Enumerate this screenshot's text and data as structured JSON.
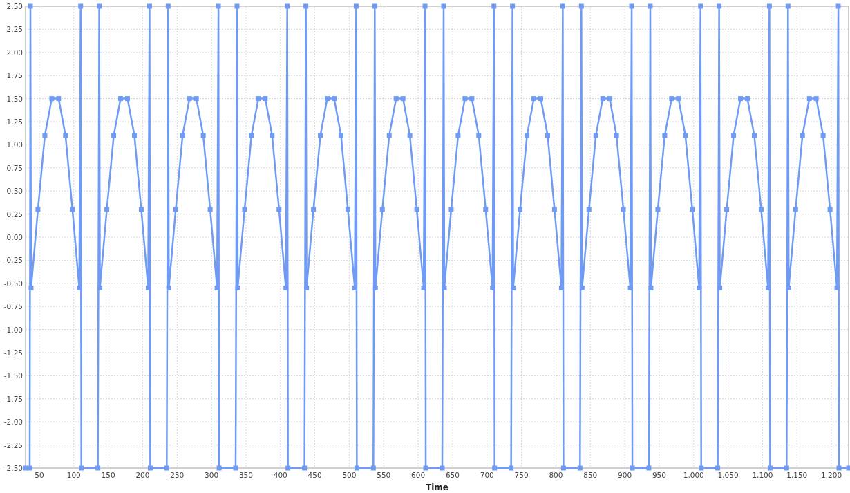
{
  "chart": {
    "chart_data": {
      "type": "line",
      "xlabel": "Time",
      "grid": true,
      "xlim": [
        30,
        1225
      ],
      "ylim": [
        -2.5,
        2.5
      ],
      "x": [
        30,
        36,
        37,
        38,
        48,
        58,
        68,
        78,
        88,
        98,
        108,
        110,
        111,
        135,
        137,
        138,
        148,
        158,
        168,
        178,
        188,
        198,
        208,
        210,
        211,
        235,
        237,
        238,
        248,
        258,
        268,
        278,
        288,
        298,
        308,
        310,
        311,
        335,
        337,
        338,
        348,
        358,
        368,
        378,
        388,
        398,
        408,
        410,
        411,
        435,
        437,
        438,
        448,
        458,
        468,
        478,
        488,
        498,
        508,
        510,
        511,
        535,
        537,
        538,
        548,
        558,
        568,
        578,
        588,
        598,
        608,
        610,
        611,
        635,
        637,
        638,
        648,
        658,
        668,
        678,
        688,
        698,
        708,
        710,
        711,
        735,
        737,
        738,
        748,
        758,
        768,
        778,
        788,
        798,
        808,
        810,
        811,
        835,
        837,
        838,
        848,
        858,
        868,
        878,
        888,
        898,
        908,
        910,
        911,
        935,
        937,
        938,
        948,
        958,
        968,
        978,
        988,
        998,
        1008,
        1010,
        1011,
        1035,
        1037,
        1038,
        1048,
        1058,
        1068,
        1078,
        1088,
        1098,
        1108,
        1110,
        1111,
        1135,
        1137,
        1138,
        1148,
        1158,
        1168,
        1178,
        1188,
        1198,
        1208,
        1210,
        1211,
        1225
      ],
      "series": [
        {
          "color": "#6f9bf4",
          "marker": "square",
          "values": [
            -2.5,
            -2.5,
            2.5,
            -0.55,
            0.3,
            1.1,
            1.5,
            1.5,
            1.1,
            0.3,
            -0.55,
            2.5,
            -2.5,
            -2.5,
            2.5,
            -0.55,
            0.3,
            1.1,
            1.5,
            1.5,
            1.1,
            0.3,
            -0.55,
            2.5,
            -2.5,
            -2.5,
            2.5,
            -0.55,
            0.3,
            1.1,
            1.5,
            1.5,
            1.1,
            0.3,
            -0.55,
            2.5,
            -2.5,
            -2.5,
            2.5,
            -0.55,
            0.3,
            1.1,
            1.5,
            1.5,
            1.1,
            0.3,
            -0.55,
            2.5,
            -2.5,
            -2.5,
            2.5,
            -0.55,
            0.3,
            1.1,
            1.5,
            1.5,
            1.1,
            0.3,
            -0.55,
            2.5,
            -2.5,
            -2.5,
            2.5,
            -0.55,
            0.3,
            1.1,
            1.5,
            1.5,
            1.1,
            0.3,
            -0.55,
            2.5,
            -2.5,
            -2.5,
            2.5,
            -0.55,
            0.3,
            1.1,
            1.5,
            1.5,
            1.1,
            0.3,
            -0.55,
            2.5,
            -2.5,
            -2.5,
            2.5,
            -0.55,
            0.3,
            1.1,
            1.5,
            1.5,
            1.1,
            0.3,
            -0.55,
            2.5,
            -2.5,
            -2.5,
            2.5,
            -0.55,
            0.3,
            1.1,
            1.5,
            1.5,
            1.1,
            0.3,
            -0.55,
            2.5,
            -2.5,
            -2.5,
            2.5,
            -0.55,
            0.3,
            1.1,
            1.5,
            1.5,
            1.1,
            0.3,
            -0.55,
            2.5,
            -2.5,
            -2.5,
            2.5,
            -0.55,
            0.3,
            1.1,
            1.5,
            1.5,
            1.1,
            0.3,
            -0.55,
            2.5,
            -2.5,
            -2.5,
            2.5,
            -0.55,
            0.3,
            1.1,
            1.5,
            1.5,
            1.1,
            0.3,
            -0.55,
            2.5,
            -2.5,
            -2.5
          ]
        }
      ],
      "xticks": [
        {
          "value": 50,
          "label": "50"
        },
        {
          "value": 100,
          "label": "100"
        },
        {
          "value": 150,
          "label": "150"
        },
        {
          "value": 200,
          "label": "200"
        },
        {
          "value": 250,
          "label": "250"
        },
        {
          "value": 300,
          "label": "300"
        },
        {
          "value": 350,
          "label": "350"
        },
        {
          "value": 400,
          "label": "400"
        },
        {
          "value": 450,
          "label": "450"
        },
        {
          "value": 500,
          "label": "500"
        },
        {
          "value": 550,
          "label": "550"
        },
        {
          "value": 600,
          "label": "600"
        },
        {
          "value": 650,
          "label": "650"
        },
        {
          "value": 700,
          "label": "700"
        },
        {
          "value": 750,
          "label": "750"
        },
        {
          "value": 800,
          "label": "800"
        },
        {
          "value": 850,
          "label": "850"
        },
        {
          "value": 900,
          "label": "900"
        },
        {
          "value": 950,
          "label": "950"
        },
        {
          "value": 1000,
          "label": "1,000"
        },
        {
          "value": 1050,
          "label": "1,050"
        },
        {
          "value": 1100,
          "label": "1,100"
        },
        {
          "value": 1150,
          "label": "1,150"
        },
        {
          "value": 1200,
          "label": "1,200"
        }
      ],
      "yticks": [
        {
          "value": 2.5,
          "label": "2.50"
        },
        {
          "value": 2.25,
          "label": "2.25"
        },
        {
          "value": 2,
          "label": "2.00"
        },
        {
          "value": 1.75,
          "label": "1.75"
        },
        {
          "value": 1.5,
          "label": "1.50"
        },
        {
          "value": 1.25,
          "label": "1.25"
        },
        {
          "value": 1,
          "label": "1.00"
        },
        {
          "value": 0.75,
          "label": "0.75"
        },
        {
          "value": 0.5,
          "label": "0.50"
        },
        {
          "value": 0.25,
          "label": "0.25"
        },
        {
          "value": 0,
          "label": "0.00"
        },
        {
          "value": -0.25,
          "label": "-0.25"
        },
        {
          "value": -0.5,
          "label": "-0.50"
        },
        {
          "value": -0.75,
          "label": "-0.75"
        },
        {
          "value": -1,
          "label": "-1.00"
        },
        {
          "value": -1.25,
          "label": "-1.25"
        },
        {
          "value": -1.5,
          "label": "-1.50"
        },
        {
          "value": -1.75,
          "label": "-1.75"
        },
        {
          "value": -2,
          "label": "-2.00"
        },
        {
          "value": -2.25,
          "label": "-2.25"
        },
        {
          "value": -2.5,
          "label": "-2.50"
        }
      ]
    }
  }
}
